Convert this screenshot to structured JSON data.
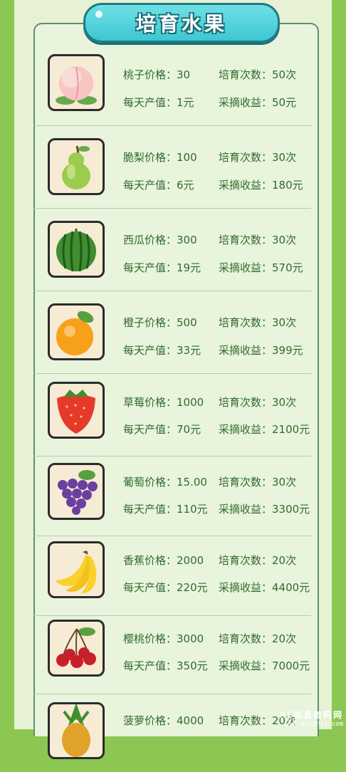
{
  "title": "培育水果",
  "fruits": [
    {
      "name_price": "桃子价格：30",
      "times": "培育次数：50次",
      "daily": "每天产值：1元",
      "harvest": "采摘收益：50元",
      "icon": "peach-icon"
    },
    {
      "name_price": "脆梨价格：100",
      "times": "培育次数：30次",
      "daily": "每天产值：6元",
      "harvest": "采摘收益：180元",
      "icon": "pear-icon"
    },
    {
      "name_price": "西瓜价格：300",
      "times": "培育次数：30次",
      "daily": "每天产值：19元",
      "harvest": "采摘收益：570元",
      "icon": "watermelon-icon"
    },
    {
      "name_price": "橙子价格：500",
      "times": "培育次数：30次",
      "daily": "每天产值：33元",
      "harvest": "采摘收益：399元",
      "icon": "orange-icon"
    },
    {
      "name_price": "草莓价格：1000",
      "times": "培育次数：30次",
      "daily": "每天产值：70元",
      "harvest": "采摘收益：2100元",
      "icon": "strawberry-icon"
    },
    {
      "name_price": "葡萄价格：15.00",
      "times": "培育次数：30次",
      "daily": "每天产值：110元",
      "harvest": "采摘收益：3300元",
      "icon": "grapes-icon"
    },
    {
      "name_price": "香蕉价格：2000",
      "times": "培育次数：20次",
      "daily": "每天产值：220元",
      "harvest": "采摘收益：4400元",
      "icon": "banana-icon"
    },
    {
      "name_price": "樱桃价格：3000",
      "times": "培育次数：20次",
      "daily": "每天产值：350元",
      "harvest": "采摘收益：7000元",
      "icon": "cherry-icon"
    },
    {
      "name_price": "菠萝价格：4000",
      "times": "培育次数：20次",
      "daily": "",
      "harvest": "",
      "icon": "pineapple-icon"
    }
  ],
  "watermark": {
    "line1": "MI信息首码网",
    "line2": "www.mixinxi.com"
  }
}
